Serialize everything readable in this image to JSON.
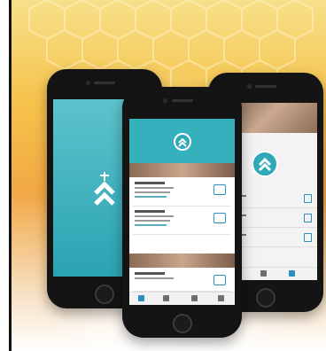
{
  "scene": {
    "description_colors": {
      "background_top": "#f6c24a",
      "background_bottom": "#ffffff",
      "phone_body": "#141414",
      "app_teal": "#35b0bd",
      "accent_blue": "#2a8fc0"
    },
    "left_phone": {
      "screen": "splash",
      "icon": "chevron-up-cross-logo-icon"
    },
    "center_phone": {
      "sections": [
        "section-band-1",
        "section-band-2"
      ],
      "list_rows": 3,
      "tab_icons": [
        "home-icon",
        "grid-icon",
        "phone-icon",
        "menu-icon"
      ]
    },
    "right_phone": {
      "screen": "detail",
      "icon": "chevron-up-cross-logo-icon"
    }
  }
}
